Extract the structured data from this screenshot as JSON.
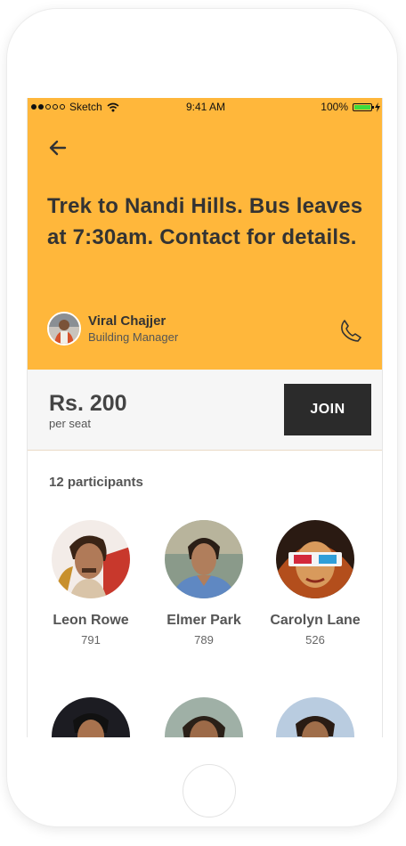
{
  "status_bar": {
    "carrier": "Sketch",
    "time": "9:41 AM",
    "battery": "100%"
  },
  "event": {
    "title": "Trek to Nandi Hills. Bus leaves at 7:30am. Contact for details.",
    "author_name": "Viral Chajjer",
    "author_role": "Building Manager"
  },
  "pricing": {
    "price": "Rs. 200",
    "unit": "per seat",
    "join_label": "JOIN"
  },
  "participants": {
    "count_label": "12 participants",
    "people": [
      {
        "name": "Leon Rowe",
        "score": "791"
      },
      {
        "name": "Elmer Park",
        "score": "789"
      },
      {
        "name": "Carolyn Lane",
        "score": "526"
      },
      {
        "name": "",
        "score": ""
      },
      {
        "name": "",
        "score": ""
      },
      {
        "name": "",
        "score": ""
      }
    ]
  },
  "colors": {
    "header": "#ffb73b",
    "join_bg": "#2b2b2b",
    "battery": "#3ddc3d"
  }
}
